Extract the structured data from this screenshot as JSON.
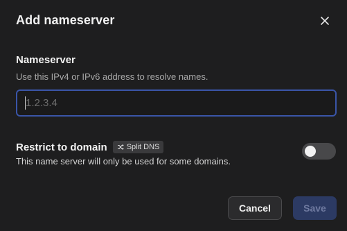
{
  "dialog": {
    "title": "Add nameserver",
    "close_icon": "close-icon"
  },
  "nameserver": {
    "label": "Nameserver",
    "helper": "Use this IPv4 or IPv6 address to resolve names.",
    "value": "",
    "placeholder": "1.2.3.4"
  },
  "restrict": {
    "label": "Restrict to domain",
    "badge_icon": "shuffle-icon",
    "badge_label": "Split DNS",
    "description": "This name server will only be used for some domains.",
    "enabled": false
  },
  "actions": {
    "cancel_label": "Cancel",
    "save_label": "Save",
    "save_disabled": true
  },
  "colors": {
    "background": "#1e1e1f",
    "input_focus_border": "#3a55a8",
    "save_disabled_bg": "#2c3a63",
    "toggle_off": "#48484a"
  }
}
